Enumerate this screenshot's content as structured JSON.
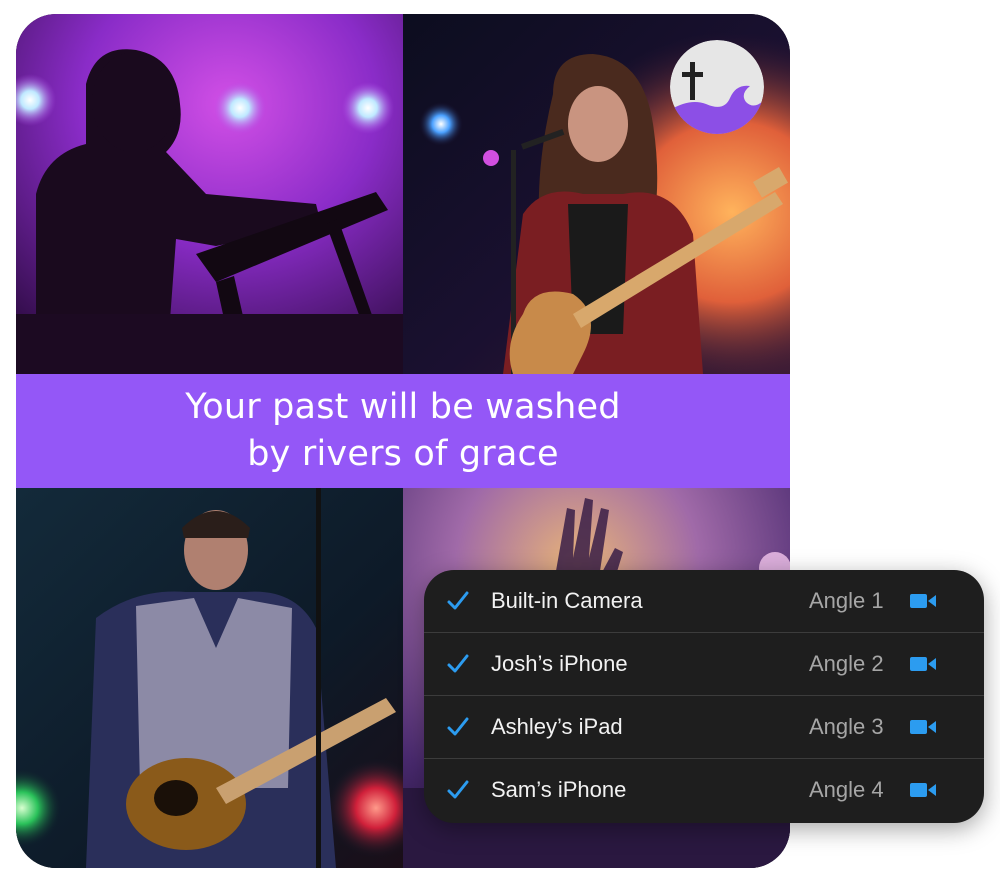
{
  "banner": {
    "line1": "Your past will be washed",
    "line2": "by rivers of grace"
  },
  "logo": {
    "icon": "cross-wave-logo"
  },
  "devices": [
    {
      "name": "Built-in Camera",
      "angle": "Angle 1",
      "checked": true
    },
    {
      "name": "Josh’s iPhone",
      "angle": "Angle 2",
      "checked": true
    },
    {
      "name": "Ashley’s iPad",
      "angle": "Angle 3",
      "checked": true
    },
    {
      "name": "Sam’s iPhone",
      "angle": "Angle 4",
      "checked": true
    }
  ],
  "colors": {
    "accent": "#9457f7",
    "check": "#2c9cf0",
    "camera": "#2c9cf0",
    "panel": "#1e1e1e"
  }
}
